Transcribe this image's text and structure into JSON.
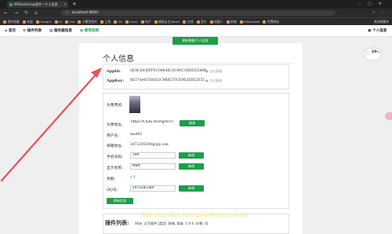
{
  "browser": {
    "tab_title": "MFBootstrap插件—个人信息",
    "url": "localhost:8604",
    "bookmarks": [
      "我的收藏",
      "有道",
      "GoogLe",
      "AI",
      "Vue",
      "大模型相关",
      "工具",
      "Go",
      "Linux",
      "电子",
      "模板自主Admin",
      "在线",
      "音乐",
      "机器人",
      "前端",
      "Editorseed",
      "免费网站"
    ],
    "bookmarks_right": "其他收藏夹"
  },
  "nav": {
    "home": "首页",
    "plugins": "插件列表",
    "server": "服务器信息",
    "guide": "使用说明",
    "personal": "个人信息"
  },
  "toast": "更新数据个人信息",
  "page": {
    "title": "个人信息",
    "appid_label": "AppId:",
    "appid_value": "8EAC6438FF0C086A6C6149C30D855584B",
    "appkey_label": "AppKey:",
    "appkey_value": "6E374A6CE8052C9B857FCE9E2EB52E55",
    "copy_label": "点击复制",
    "avatar_label": "头像预览:",
    "avatar_url_label": "头像地址:",
    "avatar_url_value": "https://t.tutu.to/img/RrI7l",
    "username_label": "用户名:",
    "username_value": "ma493",
    "email_label": "邮箱地址:",
    "email_value": "2472285384@qq.com",
    "phone_label": "手机号码:",
    "phone_value": "199",
    "display_name_label": "显示名称:",
    "display_name_value": "Matt",
    "balance_label": "余额:",
    "balance_value": "0 Y",
    "qq_label": "QQ号:",
    "qq_value": "2472285384",
    "edit_label": "修改",
    "update_label": "更新信息",
    "plugins_title": "插件列表:",
    "plugins_text": "Man_企百插件 [类型: 前端, 版本: 1.0.0, 价格: 0]",
    "watermark": "Hou hou hou hou hou houuuuuuuu"
  },
  "widget": {
    "percent": "49",
    "percent_unit": "%"
  },
  "colors": {
    "accent_green": "#1e9e4a",
    "arrow_red": "#e8505b"
  }
}
